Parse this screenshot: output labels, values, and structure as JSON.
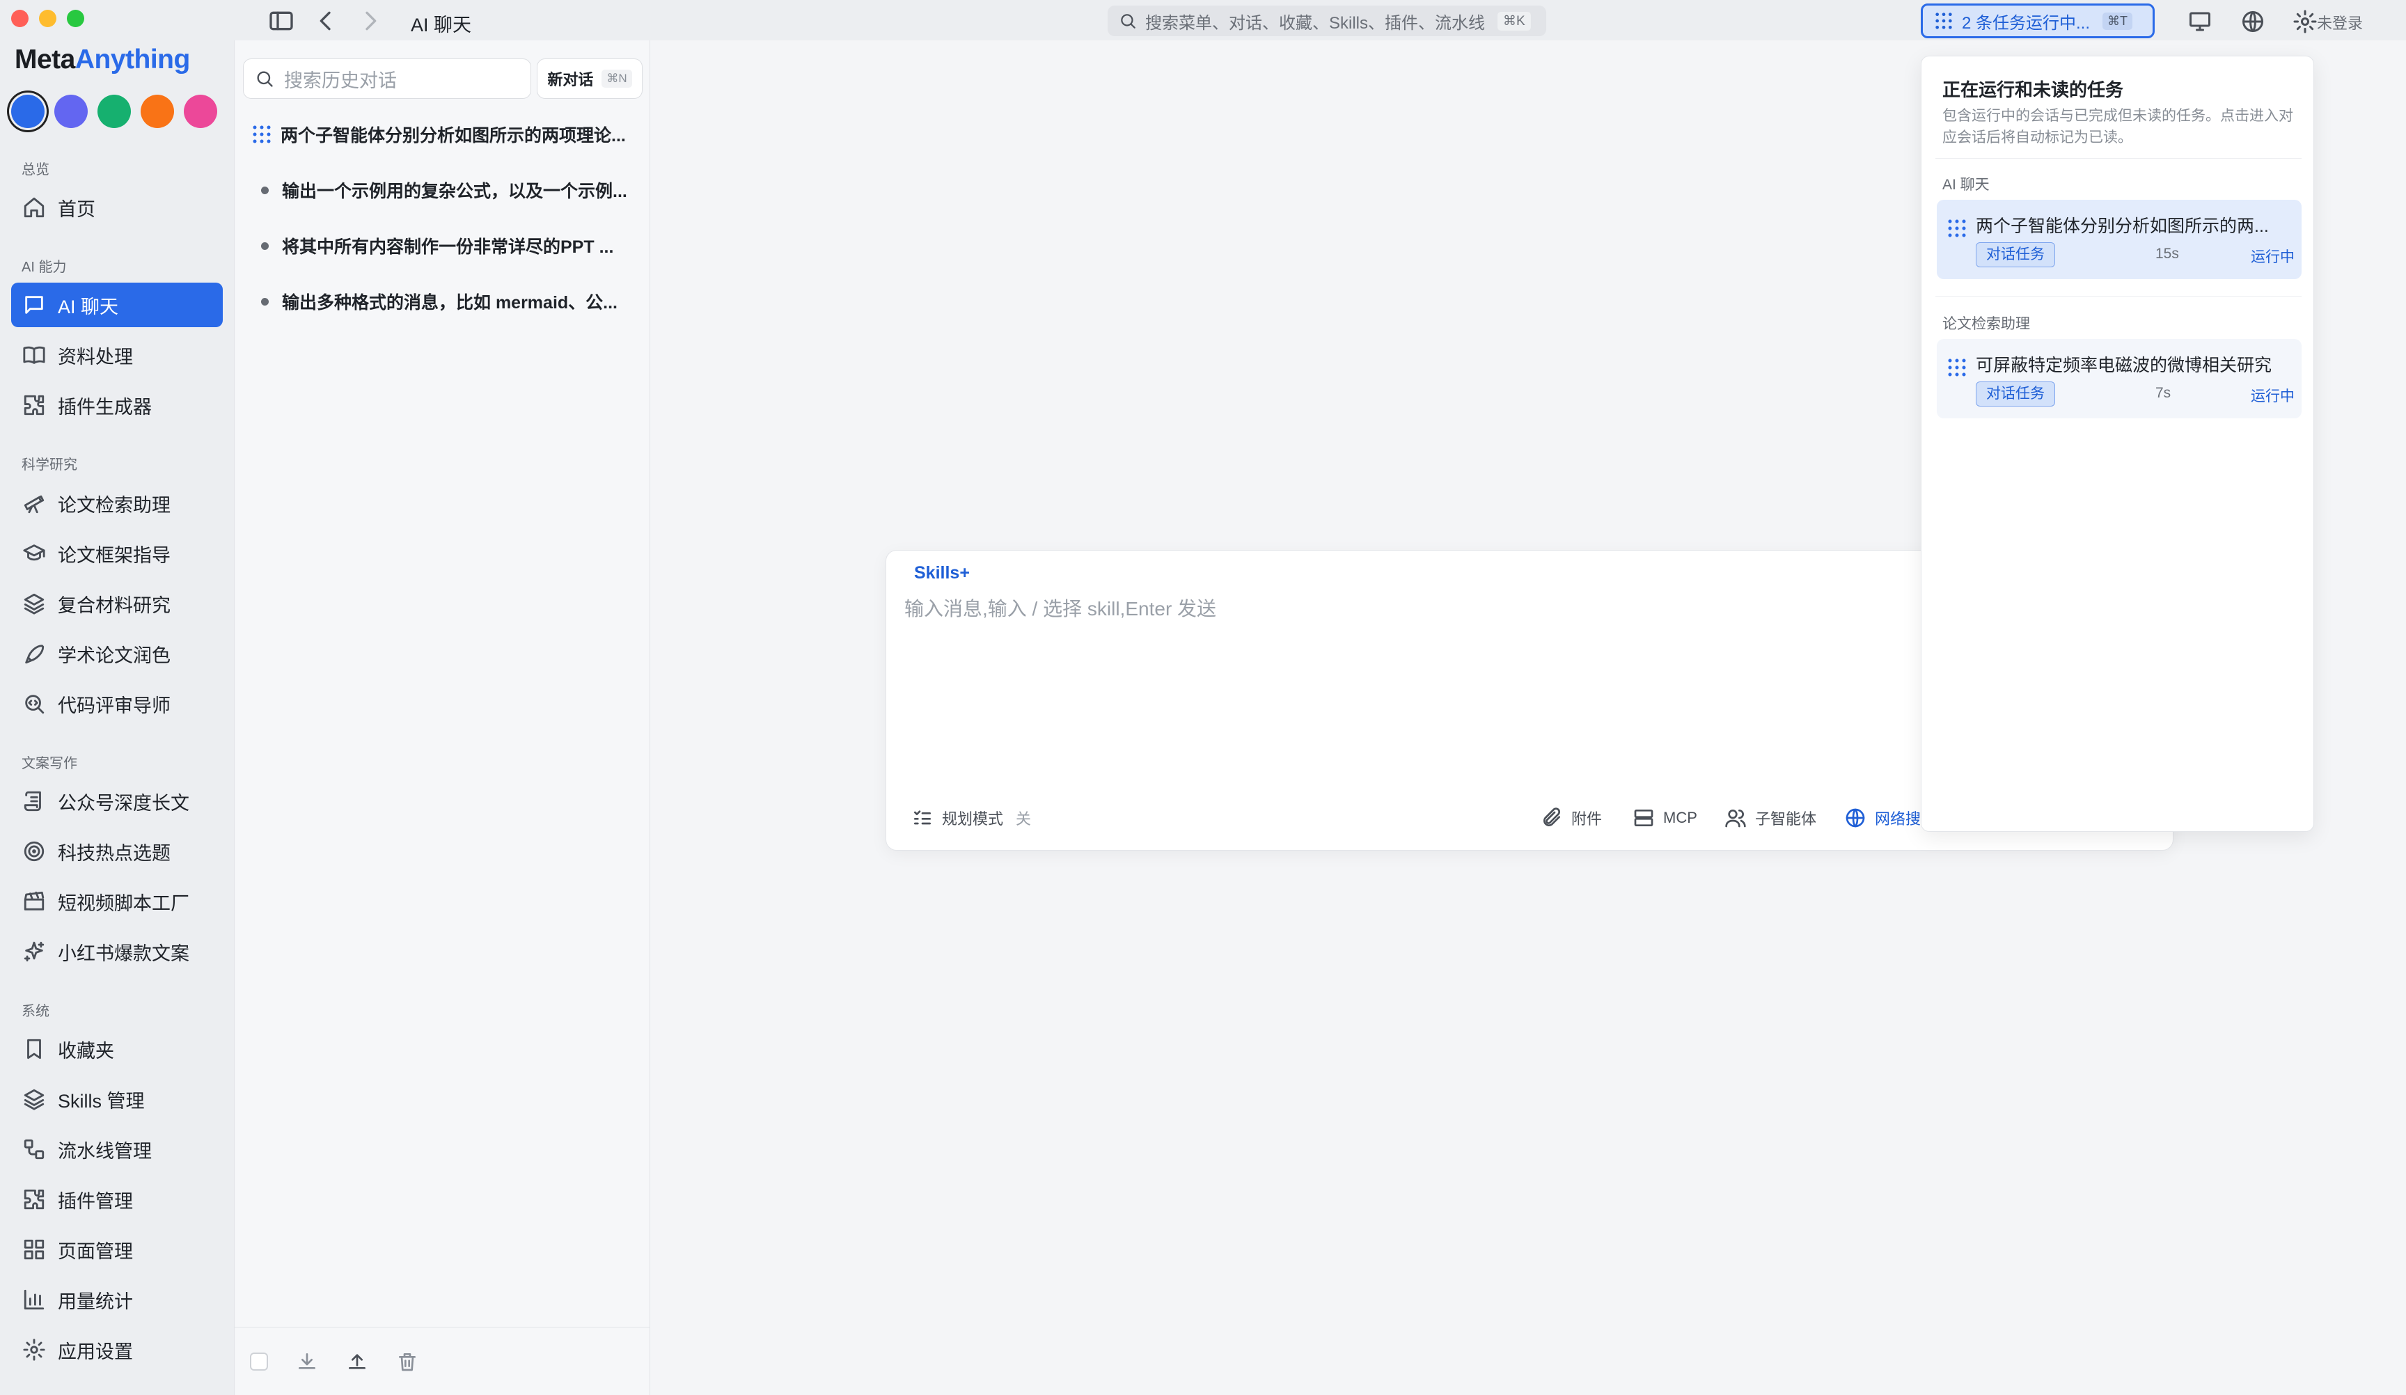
{
  "window": {
    "traffic_colors": [
      "#ff5f57",
      "#febc2e",
      "#28c840"
    ]
  },
  "brand": {
    "part1": "Meta",
    "part2": "Anything"
  },
  "theme_swatches": [
    "#2a6ae8",
    "#6366f1",
    "#16b06f",
    "#f97316",
    "#ec4899"
  ],
  "sidebar": {
    "sections": [
      {
        "label": "总览",
        "items": [
          {
            "label": "首页",
            "icon": "home-icon"
          }
        ]
      },
      {
        "label": "AI 能力",
        "items": [
          {
            "label": "AI 聊天",
            "icon": "chat-icon",
            "active": true
          },
          {
            "label": "资料处理",
            "icon": "book-icon"
          },
          {
            "label": "插件生成器",
            "icon": "puzzle-icon"
          }
        ]
      },
      {
        "label": "科学研究",
        "items": [
          {
            "label": "论文检索助理",
            "icon": "telescope-icon"
          },
          {
            "label": "论文框架指导",
            "icon": "graduation-cap-icon"
          },
          {
            "label": "复合材料研究",
            "icon": "layers-icon"
          },
          {
            "label": "学术论文润色",
            "icon": "pen-icon"
          },
          {
            "label": "代码评审导师",
            "icon": "code-search-icon"
          }
        ]
      },
      {
        "label": "文案写作",
        "items": [
          {
            "label": "公众号深度长文",
            "icon": "scroll-icon"
          },
          {
            "label": "科技热点选题",
            "icon": "target-icon"
          },
          {
            "label": "短视频脚本工厂",
            "icon": "clapperboard-icon"
          },
          {
            "label": "小红书爆款文案",
            "icon": "sparkles-icon"
          }
        ]
      },
      {
        "label": "系统",
        "items": [
          {
            "label": "收藏夹",
            "icon": "bookmark-icon"
          },
          {
            "label": "Skills 管理",
            "icon": "layers-icon"
          },
          {
            "label": "流水线管理",
            "icon": "workflow-icon"
          },
          {
            "label": "插件管理",
            "icon": "puzzle-icon"
          },
          {
            "label": "页面管理",
            "icon": "grid-icon"
          },
          {
            "label": "用量统计",
            "icon": "bar-chart-icon"
          },
          {
            "label": "应用设置",
            "icon": "gear-icon"
          }
        ]
      }
    ]
  },
  "history": {
    "search_placeholder": "搜索历史对话",
    "new_chat": "新对话",
    "new_chat_kbd": "⌘N",
    "items": [
      {
        "title": "两个子智能体分别分析如图所示的两项理论...",
        "running": true
      },
      {
        "title": "输出一个示例用的复杂公式，以及一个示例..."
      },
      {
        "title": "将其中所有内容制作一份非常详尽的PPT ..."
      },
      {
        "title": "输出多种格式的消息，比如 mermaid、公..."
      }
    ]
  },
  "topbar": {
    "breadcrumb": "AI 聊天",
    "search_placeholder": "搜索菜单、对话、收藏、Skills、插件、流水线",
    "search_kbd": "⌘K",
    "tasks_label": "2 条任务运行中...",
    "tasks_kbd": "⌘T",
    "login": "未登录"
  },
  "composer": {
    "skills_label": "Skills+",
    "placeholder": "输入消息,输入 / 选择 skill,Enter 发送",
    "plan_mode": "规划模式",
    "plan_mode_state": "关",
    "attach": "附件",
    "mcp": "MCP",
    "subagent": "子智能体",
    "web_search": "网络搜"
  },
  "popover": {
    "title": "正在运行和未读的任务",
    "description": "包含运行中的会话与已完成但未读的任务。点击进入对应会话后将自动标记为已读。",
    "groups": [
      {
        "label": "AI 聊天",
        "tasks": [
          {
            "title": "两个子智能体分别分析如图所示的两...",
            "badge": "对话任务",
            "time": "15s",
            "status": "运行中"
          }
        ]
      },
      {
        "label": "论文检索助理",
        "tasks": [
          {
            "title": "可屏蔽特定频率电磁波的微博相关研究",
            "badge": "对话任务",
            "time": "7s",
            "status": "运行中"
          }
        ]
      }
    ]
  }
}
